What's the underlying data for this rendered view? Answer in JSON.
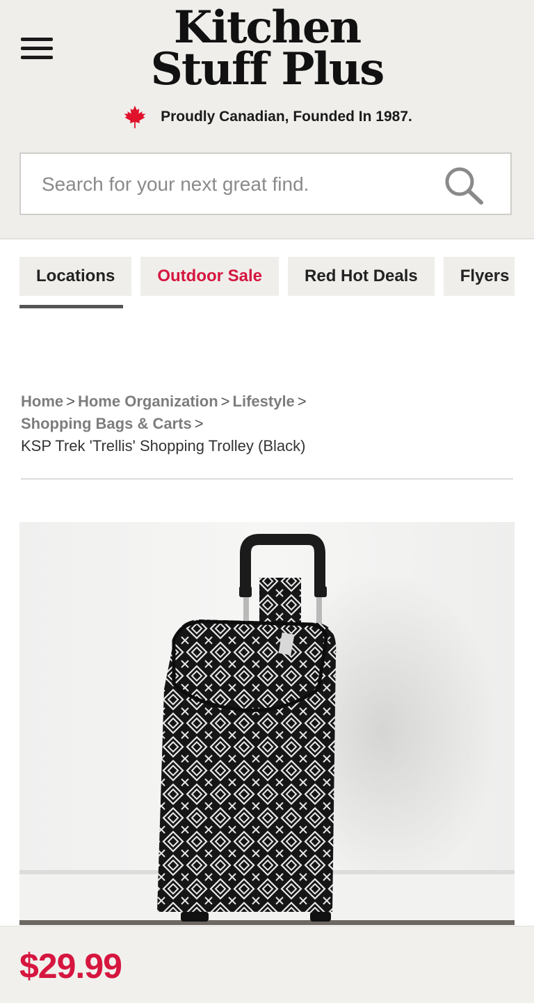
{
  "brand": {
    "logo_line1": "Kitchen",
    "logo_line2": "Stuff Plus",
    "tagline": "Proudly Canadian, Founded In 1987."
  },
  "search": {
    "placeholder": "Search for your next great find.",
    "value": ""
  },
  "nav": {
    "tabs": [
      {
        "label": "Locations",
        "active": true
      },
      {
        "label": "Outdoor Sale",
        "highlight": true
      },
      {
        "label": "Red Hot Deals"
      },
      {
        "label": "Flyers & Catalogues"
      }
    ]
  },
  "breadcrumb": {
    "items": [
      "Home",
      "Home Organization",
      "Lifestyle",
      "Shopping Bags & Carts"
    ],
    "separator": ">",
    "current": "KSP Trek 'Trellis' Shopping Trolley (Black)"
  },
  "product": {
    "price": "$29.99"
  },
  "colors": {
    "accent_red": "#d6163f",
    "header_bg": "#efeeeb"
  },
  "icons": {
    "menu": "hamburger-icon",
    "flag": "maple-leaf-icon",
    "search": "search-icon"
  }
}
